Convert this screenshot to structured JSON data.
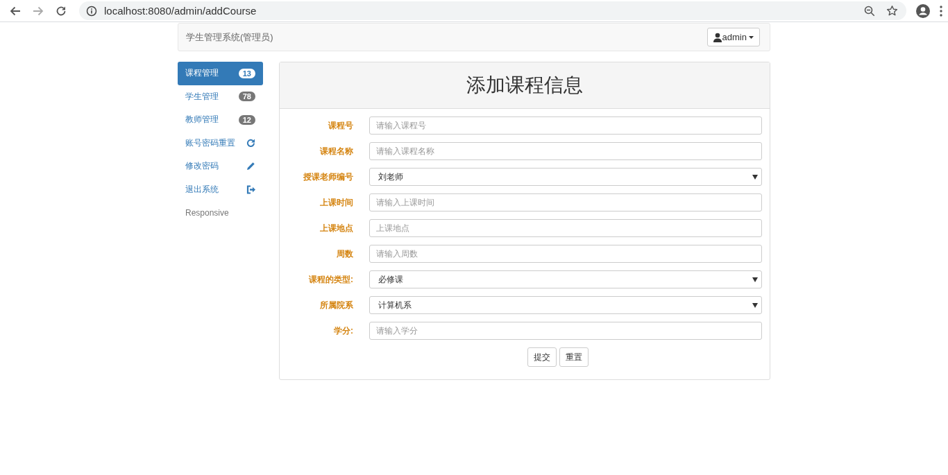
{
  "browser": {
    "url": "localhost:8080/admin/addCourse",
    "forward_disabled": true
  },
  "navbar": {
    "brand": "学生管理系统(管理员)",
    "user": "admin"
  },
  "sidebar": {
    "items": [
      {
        "label": "课程管理",
        "kind": "badge",
        "badge": "13",
        "selected": true
      },
      {
        "label": "学生管理",
        "kind": "badge",
        "badge": "78",
        "selected": false
      },
      {
        "label": "教师管理",
        "kind": "badge",
        "badge": "12",
        "selected": false
      },
      {
        "label": "账号密码重置",
        "kind": "refresh",
        "selected": false
      },
      {
        "label": "修改密码",
        "kind": "edit",
        "selected": false
      },
      {
        "label": "退出系统",
        "kind": "logout",
        "selected": false
      },
      {
        "label": "Responsive",
        "kind": "plain",
        "selected": false
      }
    ]
  },
  "panel": {
    "title": "添加课程信息",
    "fields": [
      {
        "label": "课程号",
        "kind": "input",
        "placeholder": "请输入课程号"
      },
      {
        "label": "课程名称",
        "kind": "input",
        "placeholder": "请输入课程名称"
      },
      {
        "label": "授课老师编号",
        "kind": "select",
        "value": "刘老师"
      },
      {
        "label": "上课时间",
        "kind": "input",
        "placeholder": "请输入上课时间"
      },
      {
        "label": "上课地点",
        "kind": "input",
        "placeholder": "上课地点"
      },
      {
        "label": "周数",
        "kind": "input",
        "placeholder": "请输入周数"
      },
      {
        "label": "课程的类型:",
        "kind": "select",
        "value": "必修课"
      },
      {
        "label": "所属院系",
        "kind": "select",
        "value": "计算机系"
      },
      {
        "label": "学分:",
        "kind": "input",
        "placeholder": "请输入学分"
      }
    ],
    "buttons": [
      "提交",
      "重置"
    ]
  }
}
